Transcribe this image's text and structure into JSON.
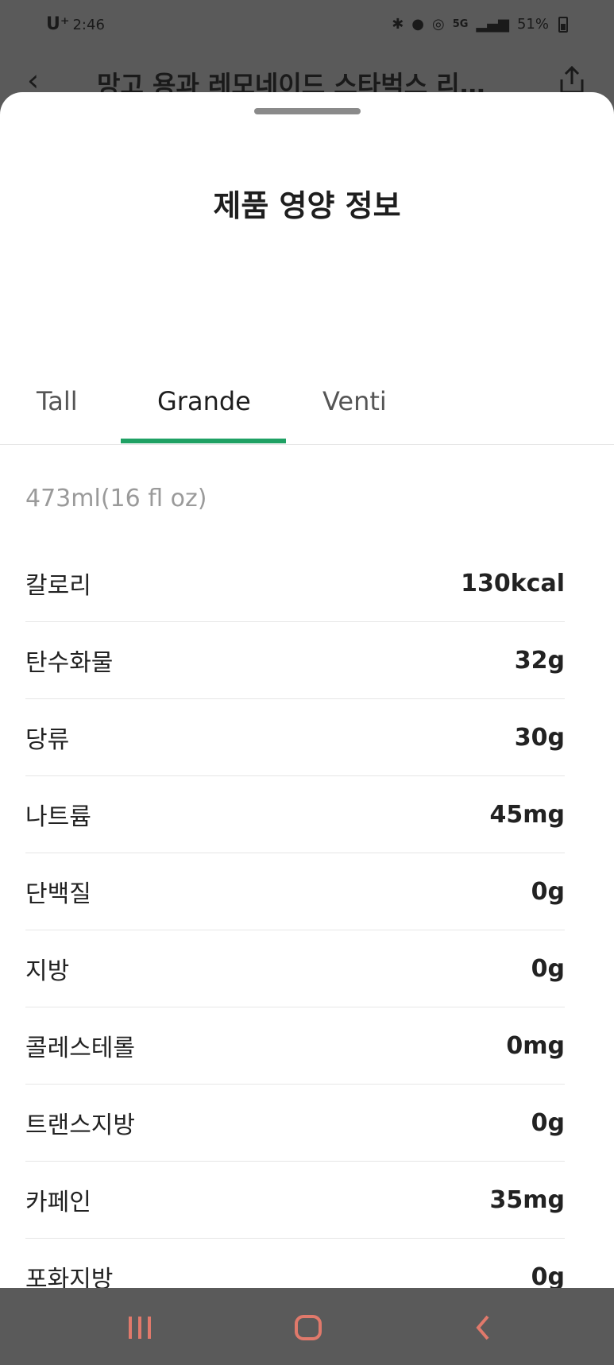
{
  "status_bar": {
    "carrier": "U⁺",
    "time": "2:46",
    "battery": "51%"
  },
  "underlying_header": {
    "title": "망고 용과 레모네이드 스타벅스 리…"
  },
  "sheet": {
    "title": "제품 영양 정보",
    "tabs": [
      {
        "label": "Tall",
        "active": false
      },
      {
        "label": "Grande",
        "active": true
      },
      {
        "label": "Venti",
        "active": false
      }
    ],
    "size_label": "473ml(16 fl oz)",
    "nutrition": [
      {
        "label": "칼로리",
        "value": "130kcal"
      },
      {
        "label": "탄수화물",
        "value": "32g"
      },
      {
        "label": "당류",
        "value": "30g"
      },
      {
        "label": "나트륨",
        "value": "45mg"
      },
      {
        "label": "단백질",
        "value": "0g"
      },
      {
        "label": "지방",
        "value": "0g"
      },
      {
        "label": "콜레스테롤",
        "value": "0mg"
      },
      {
        "label": "트랜스지방",
        "value": "0g"
      },
      {
        "label": "카페인",
        "value": "35mg"
      },
      {
        "label": "포화지방",
        "value": "0g"
      }
    ]
  },
  "colors": {
    "accent": "#1fa164",
    "nav_icon": "#e0796b",
    "scrim": "#5a5a5a"
  },
  "icons": {
    "back": "chevron-left-icon",
    "share": "share-icon",
    "nav_recent": "recent-apps-icon",
    "nav_home": "home-icon",
    "nav_back": "back-icon"
  }
}
